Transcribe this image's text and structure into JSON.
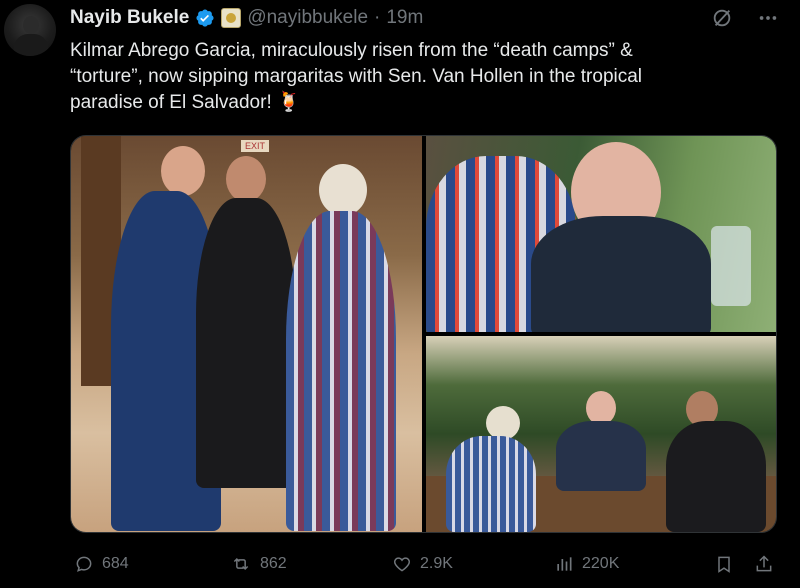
{
  "author": {
    "name": "Nayib Bukele",
    "handle": "@nayibbukele",
    "separator": "·",
    "time": "19m",
    "verified_color": "#1d9bf0"
  },
  "tweet": {
    "text": "Kilmar Abrego Garcia, miraculously risen from the “death camps” &\n“torture”, now sipping margaritas with Sen. Van Hollen in the tropical\nparadise of El Salvador! 🍹"
  },
  "media": {
    "images": [
      {
        "name": "handshake-photo"
      },
      {
        "name": "closeup-photo"
      },
      {
        "name": "table-photo"
      }
    ],
    "sign_text": "EXIT"
  },
  "actions": {
    "replies": "684",
    "reposts": "862",
    "likes": "2.9K",
    "views": "220K"
  },
  "colors": {
    "background": "#000000",
    "text": "#e7e9ea",
    "muted": "#71767b",
    "accent": "#1d9bf0"
  }
}
